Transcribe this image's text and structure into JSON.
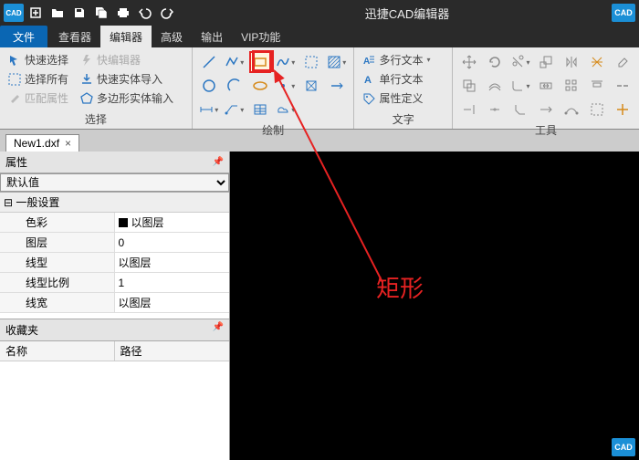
{
  "app": {
    "title": "迅捷CAD编辑器",
    "badge": "CAD"
  },
  "menu": {
    "file": "文件",
    "viewer": "查看器",
    "editor": "编辑器",
    "advanced": "高级",
    "output": "输出",
    "vip": "VIP功能"
  },
  "ribbon": {
    "select": {
      "label": "选择",
      "quick_select": "快速选择",
      "select_all": "选择所有",
      "match_props": "匹配属性",
      "quick_editor": "快编辑器",
      "quick_entity_import": "快速实体导入",
      "polygon_entity_input": "多边形实体输入"
    },
    "draw": {
      "label": "绘制"
    },
    "text": {
      "label": "文字",
      "mtext": "多行文本",
      "stext": "单行文本",
      "attdef": "属性定义"
    },
    "tools": {
      "label": "工具"
    }
  },
  "filetab": {
    "name": "New1.dxf"
  },
  "props": {
    "panel": "属性",
    "combo": "默认值",
    "section": "一般设置",
    "rows": {
      "color": {
        "k": "色彩",
        "v": "以图层"
      },
      "layer": {
        "k": "图层",
        "v": "0"
      },
      "ltype": {
        "k": "线型",
        "v": "以图层"
      },
      "lscale": {
        "k": "线型比例",
        "v": "1"
      },
      "lweight": {
        "k": "线宽",
        "v": "以图层"
      }
    }
  },
  "favorites": {
    "panel": "收藏夹",
    "col_name": "名称",
    "col_path": "路径"
  },
  "annotation": {
    "label": "矩形"
  }
}
